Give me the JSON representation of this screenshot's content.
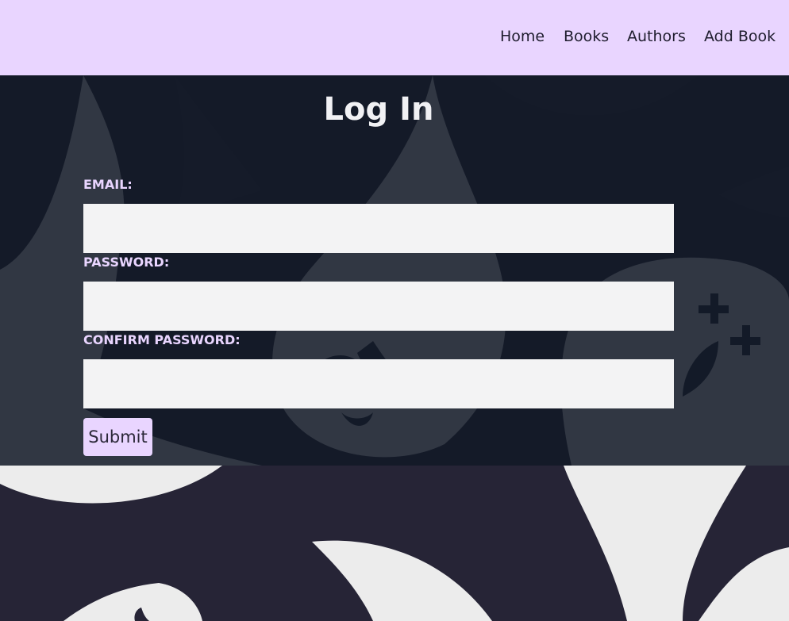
{
  "nav": {
    "items": [
      {
        "label": "Home"
      },
      {
        "label": "Books"
      },
      {
        "label": "Authors"
      },
      {
        "label": "Add Book"
      }
    ]
  },
  "page": {
    "title": "Log In"
  },
  "form": {
    "email_label": "EMAIL:",
    "email_value": "",
    "password_label": "PASSWORD:",
    "password_value": "",
    "confirm_label": "CONFIRM PASSWORD:",
    "confirm_value": "",
    "submit_label": "Submit"
  },
  "colors": {
    "nav_background": "#e9d5ff",
    "label_accent": "#e9d5ff",
    "panel_background": "#111827",
    "page_background": "#262436",
    "input_background": "#f3f3f4"
  }
}
